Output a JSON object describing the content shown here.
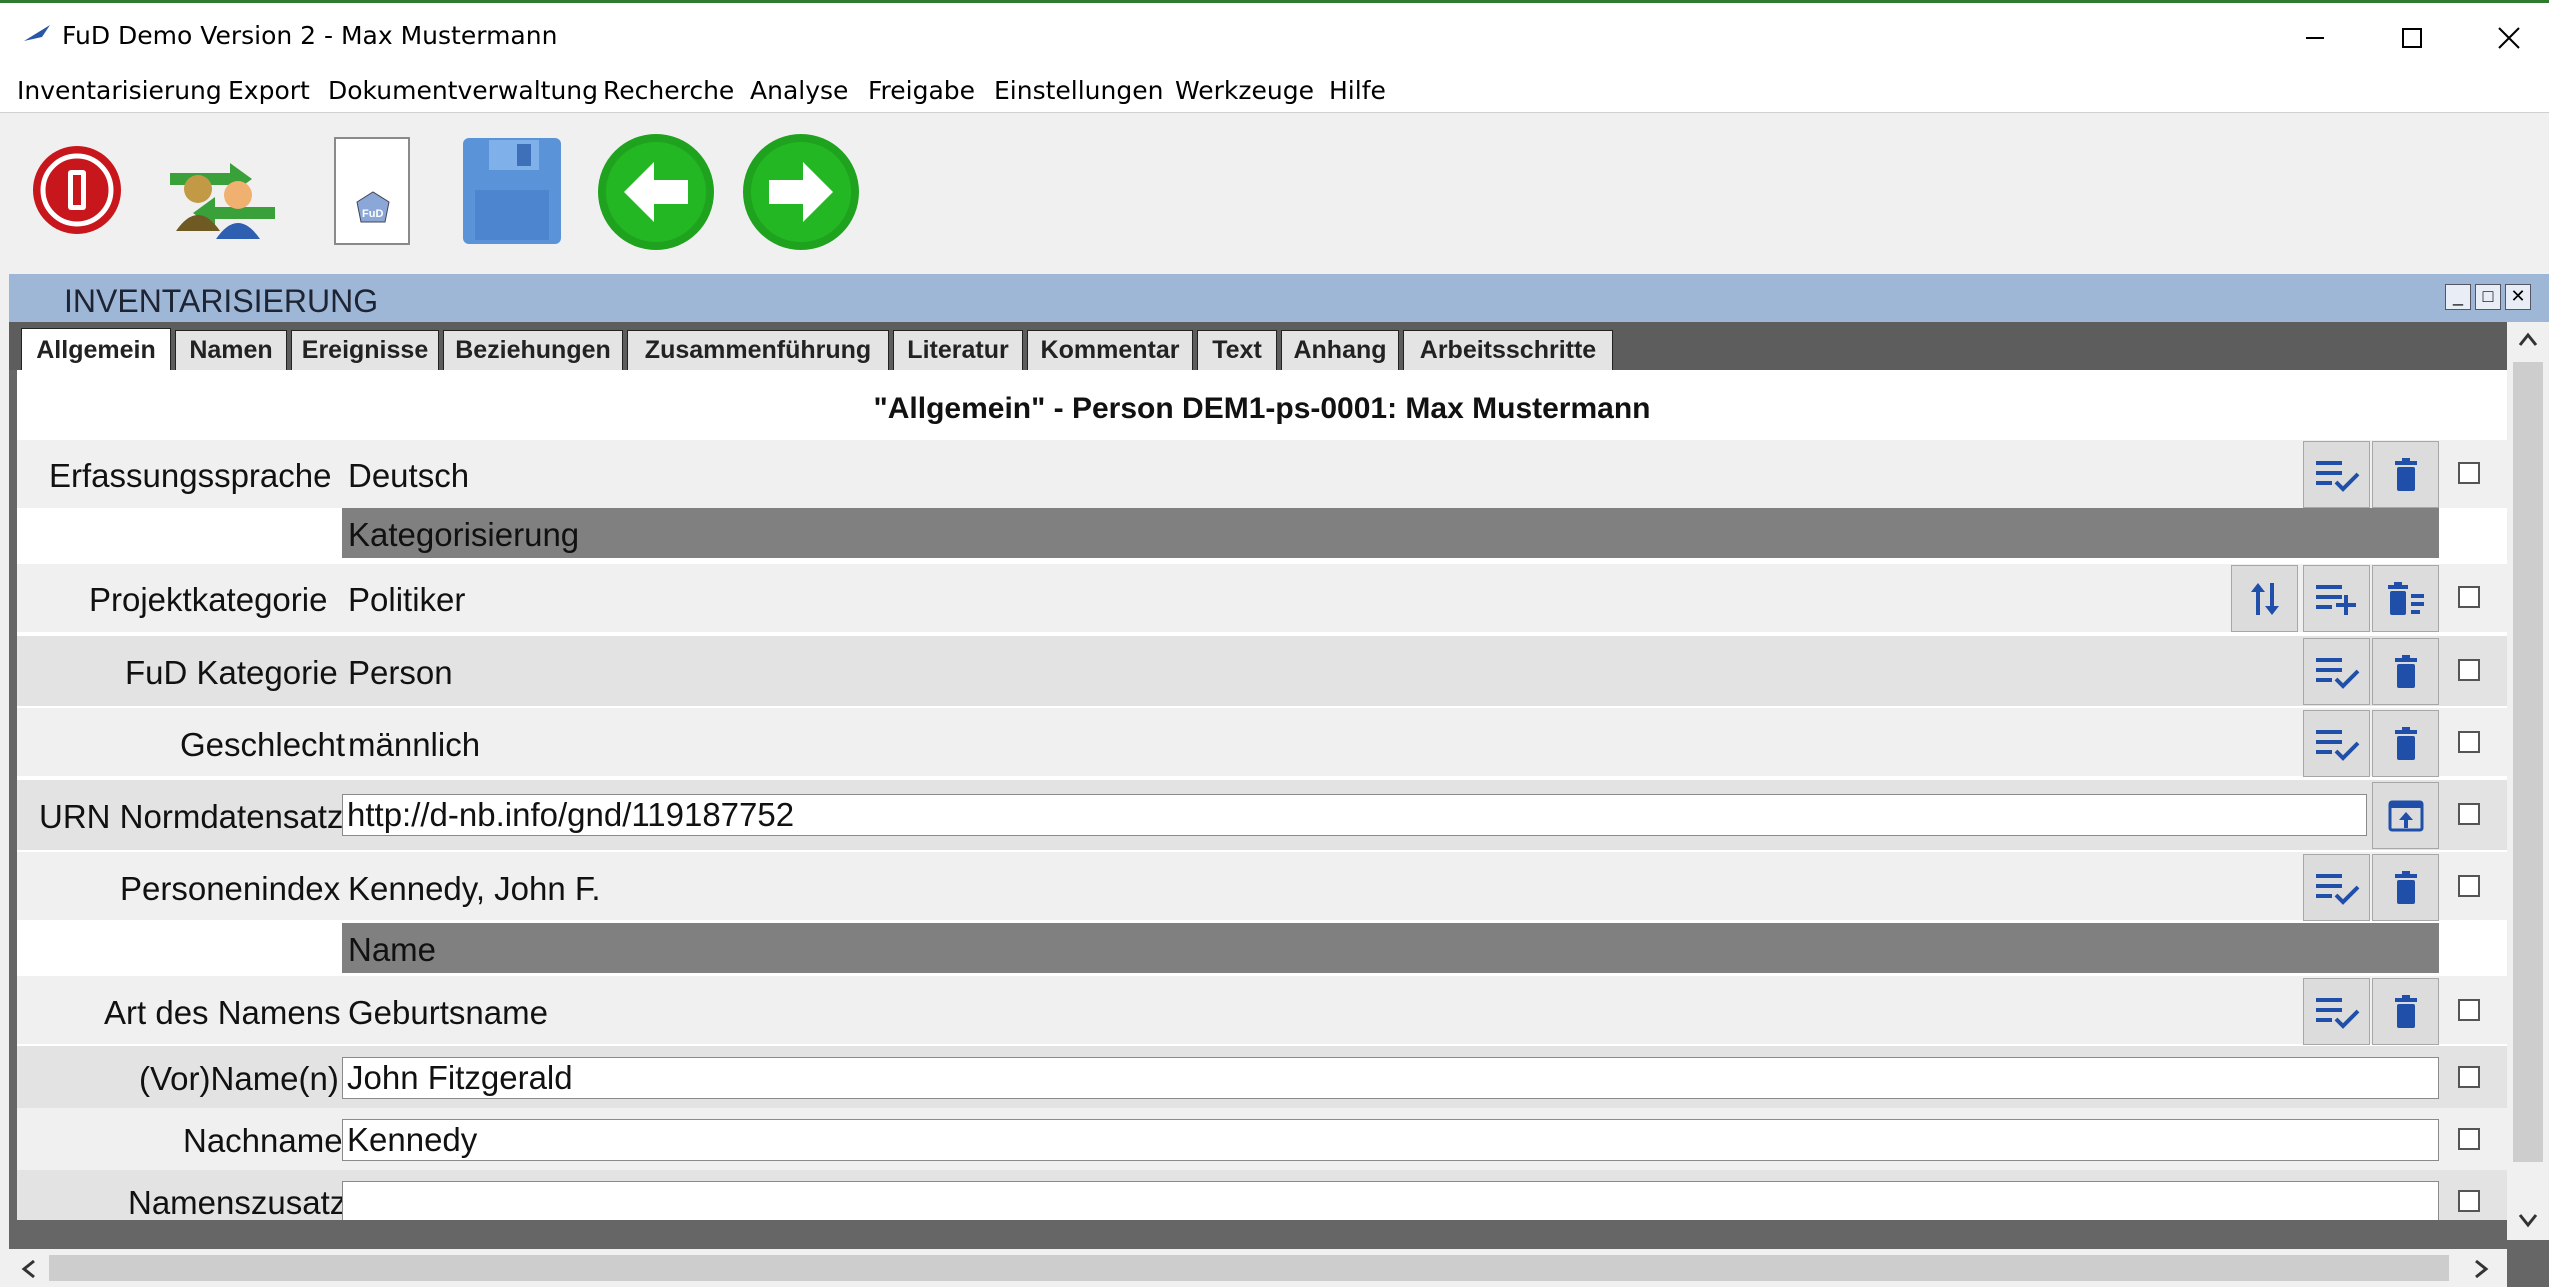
{
  "window": {
    "title": "FuD Demo Version 2 - Max Mustermann"
  },
  "menu": {
    "items": [
      "Inventarisierung",
      "Export",
      "Dokumentverwaltung",
      "Recherche",
      "Analyse",
      "Freigabe",
      "Einstellungen",
      "Werkzeuge",
      "Hilfe"
    ]
  },
  "toolbar": {
    "doc_badge": "FuD"
  },
  "frame": {
    "title": "INVENTARISIERUNG"
  },
  "tabs": [
    "Allgemein",
    "Namen",
    "Ereignisse",
    "Beziehungen",
    "Zusammenführung",
    "Literatur",
    "Kommentar",
    "Text",
    "Anhang",
    "Arbeitsschritte"
  ],
  "content": {
    "heading": "\"Allgemein\" - Person DEM1-ps-0001: Max Mustermann",
    "fields": {
      "erfassungssprache": {
        "label": "Erfassungssprache",
        "value": "Deutsch"
      },
      "kategorisierung": {
        "label": "Kategorisierung"
      },
      "projektkategorie": {
        "label": "Projektkategorie",
        "value": "Politiker"
      },
      "fud_kategorie": {
        "label": "FuD Kategorie",
        "value": "Person"
      },
      "geschlecht": {
        "label": "Geschlecht",
        "value": "männlich"
      },
      "urn": {
        "label": "URN Normdatensatz",
        "value": "http://d-nb.info/gnd/119187752"
      },
      "personenindex": {
        "label": "Personenindex",
        "value": "Kennedy, John F."
      },
      "name_group": {
        "label": "Name"
      },
      "art_des_namens": {
        "label": "Art des Namens",
        "value": "Geburtsname"
      },
      "vorname": {
        "label": "(Vor)Name(n)",
        "value": "John Fitzgerald"
      },
      "nachname": {
        "label": "Nachname",
        "value": "Kennedy"
      },
      "namenszusatz": {
        "label": "Namenszusatz",
        "value": ""
      }
    }
  },
  "colors": {
    "frame_title_bg": "#9fb7d6",
    "action_icon": "#1f4fa8",
    "group_bar": "#808080",
    "nav_green": "#1fa31f",
    "exit_red": "#c8161d"
  }
}
